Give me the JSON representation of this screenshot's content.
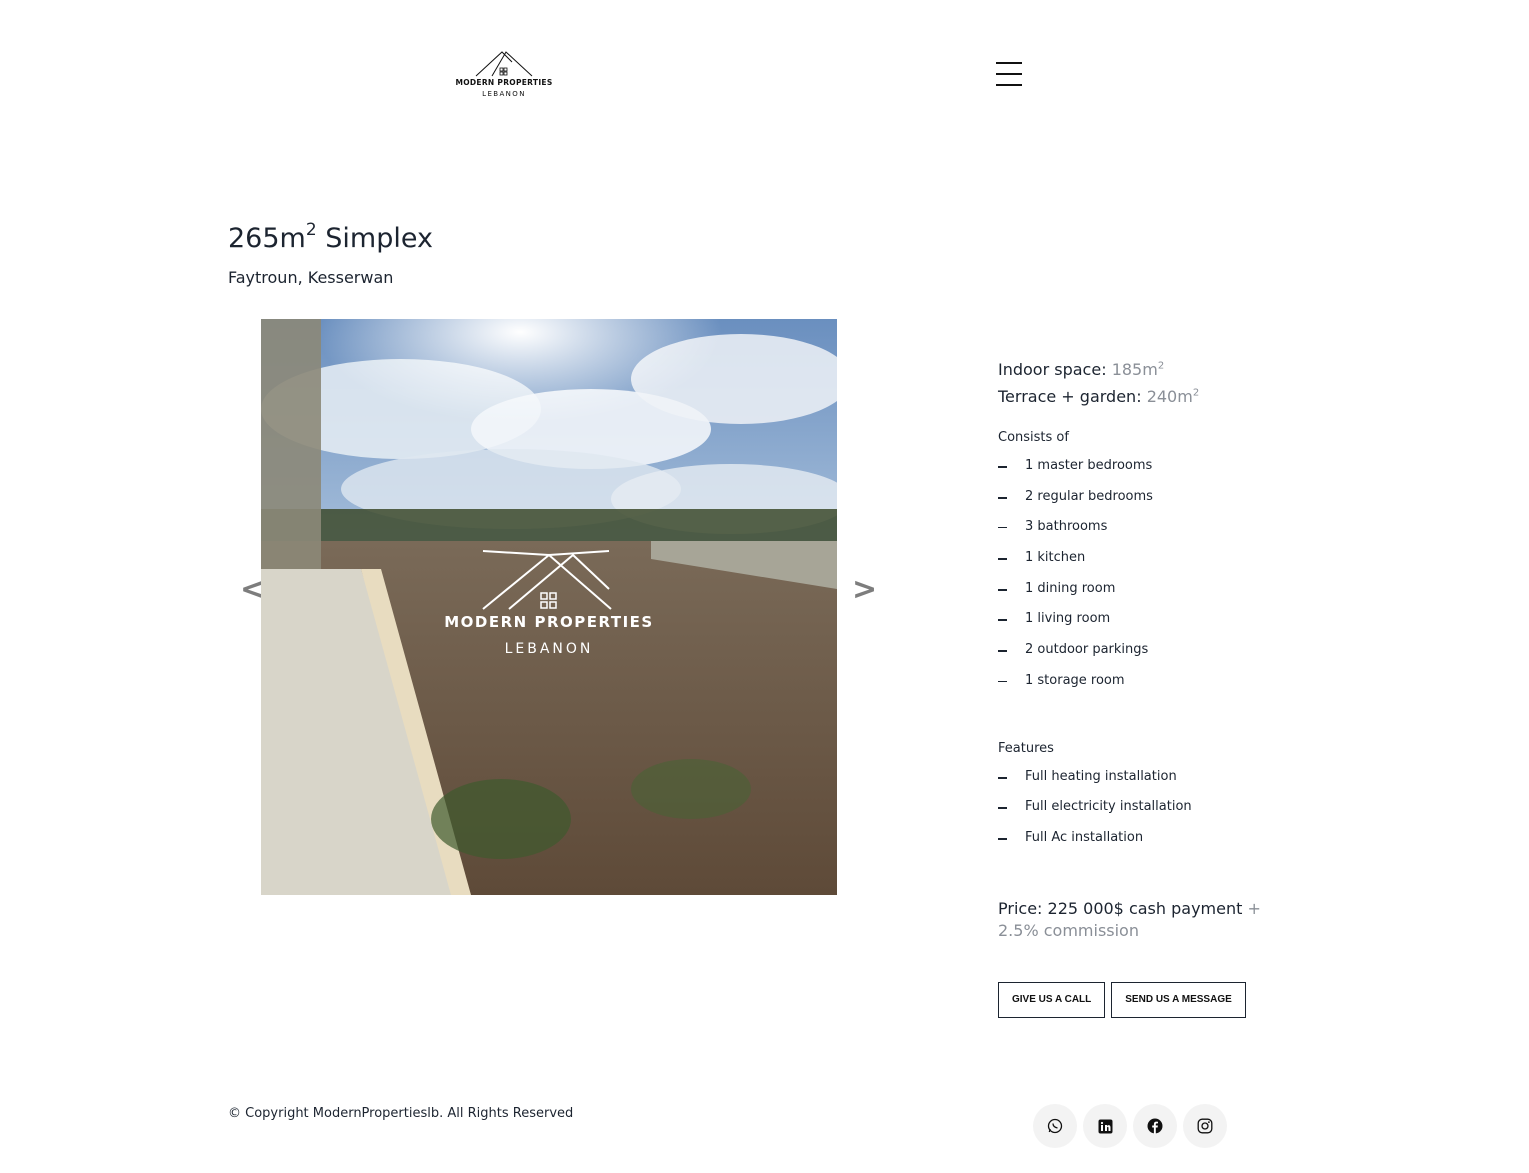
{
  "header": {
    "logo_brand": "MODERN PROPERTIES",
    "logo_sub": "LEBANON",
    "menu_icon": "hamburger-menu-icon"
  },
  "listing": {
    "title_main": "265m",
    "title_sup": "2",
    "title_rest": " Simplex",
    "location": "Faytroun, Kesserwan"
  },
  "gallery": {
    "prev_label": "<",
    "next_label": ">",
    "watermark_brand": "MODERN PROPERTIES",
    "watermark_sub": "LEBANON"
  },
  "specs": {
    "indoor_label": "Indoor space:",
    "indoor_value": "185m",
    "indoor_sup": "2",
    "terrace_label": "Terrace + garden:",
    "terrace_value": "240m",
    "terrace_sup": "2"
  },
  "consists": {
    "title": "Consists of",
    "items": [
      "1 master bedrooms",
      "2 regular bedrooms",
      "3 bathrooms",
      "1 kitchen",
      "1 dining room",
      "1 living room",
      "2 outdoor parkings",
      "1 storage room"
    ]
  },
  "features": {
    "title": "Features",
    "items": [
      "Full heating installation",
      "Full electricity installation",
      "Full Ac installation"
    ]
  },
  "price": {
    "main": "Price: 225 000$ cash payment",
    "extra": "+ 2.5% commission"
  },
  "actions": {
    "call_label": "GIVE US A CALL",
    "message_label": "SEND US A MESSAGE"
  },
  "footer": {
    "copyright": "© Copyright ModernPropertieslb. All Rights Reserved",
    "socials": [
      "whatsapp-icon",
      "linkedin-icon",
      "facebook-icon",
      "instagram-icon"
    ]
  }
}
